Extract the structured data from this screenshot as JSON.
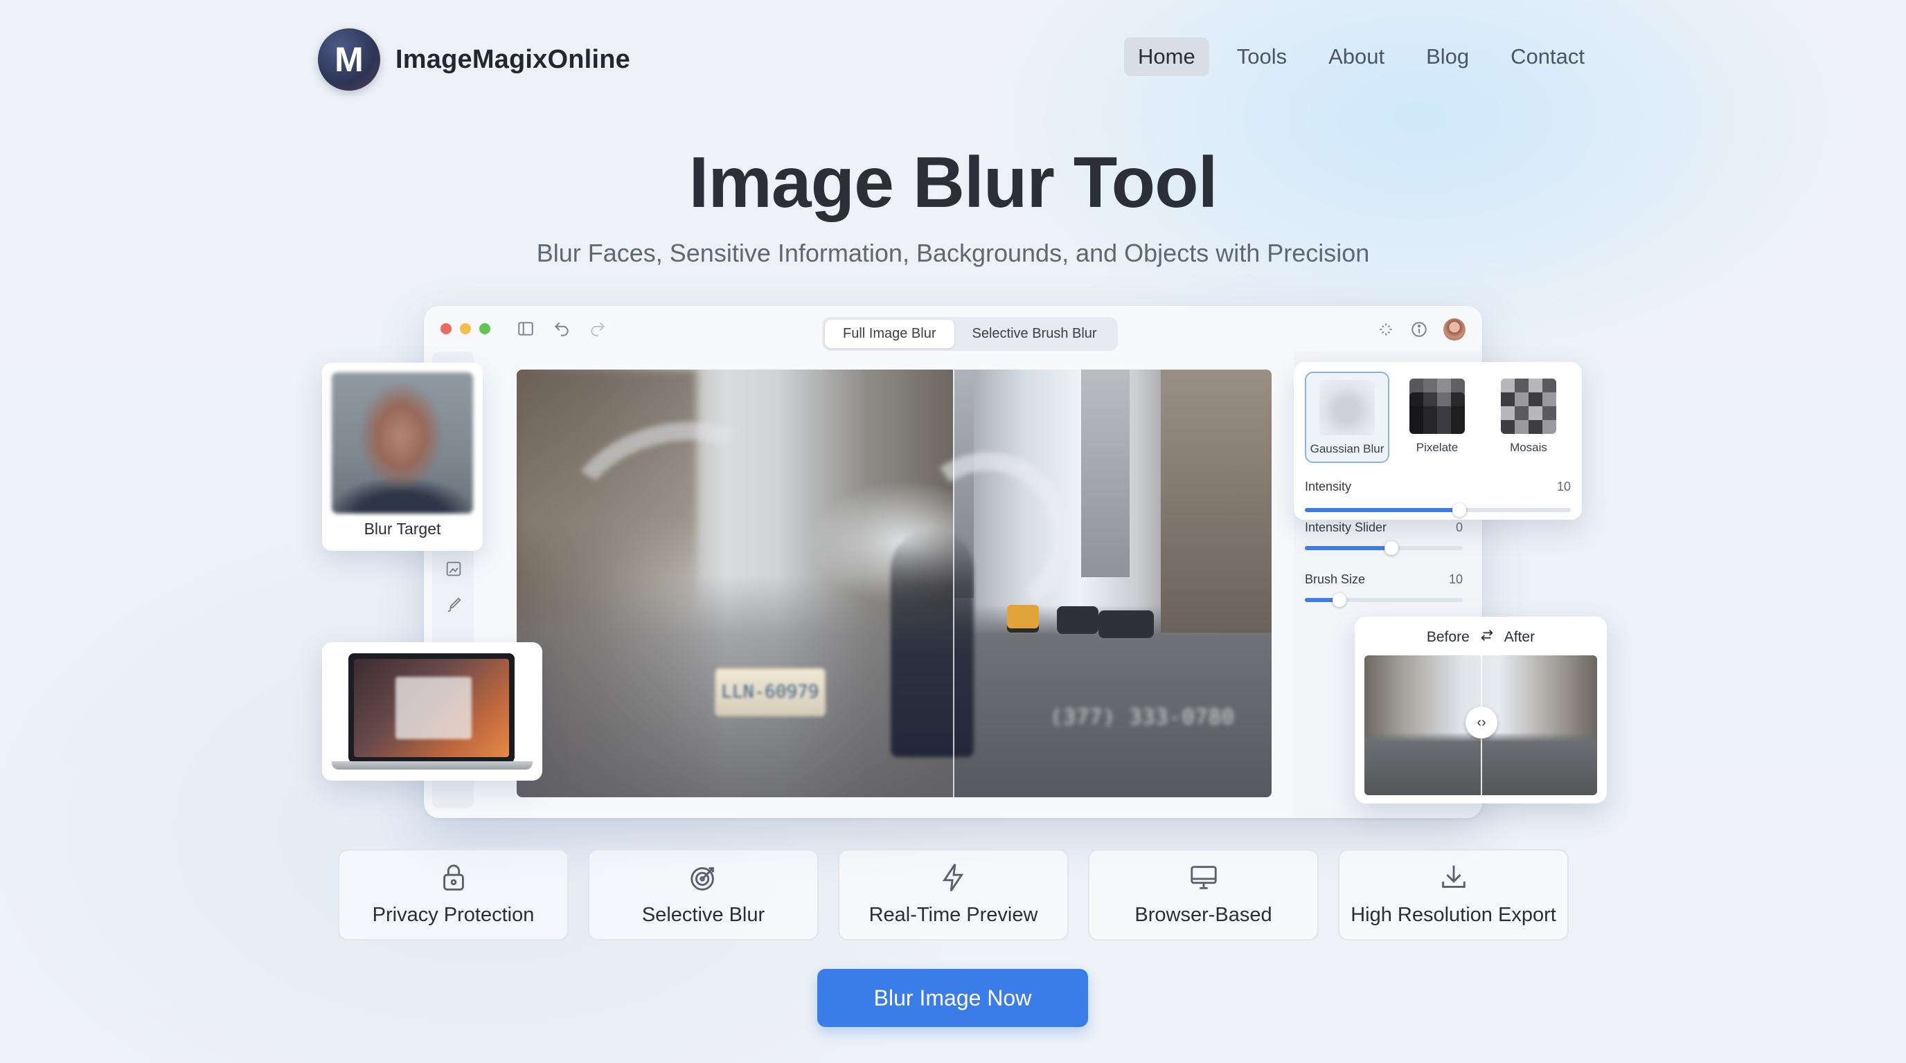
{
  "brand": {
    "logo_letter": "M",
    "name": "ImageMagixOnline"
  },
  "nav": {
    "items": [
      "Home",
      "Tools",
      "About",
      "Blog",
      "Contact"
    ],
    "active": "Home"
  },
  "hero": {
    "title": "Image Blur Tool",
    "subtitle": "Blur Faces, Sensitive Information, Backgrounds, and Objects with Precision"
  },
  "editor": {
    "modes": [
      "Full Image Blur",
      "Selective Brush Blur"
    ],
    "active_mode": "Full Image Blur",
    "plate_text": "LLN-60979",
    "phone_text": "(377) 333-0780"
  },
  "effects": {
    "options": [
      "Gaussian Blur",
      "Pixelate",
      "Mosais"
    ],
    "selected": "Gaussian Blur"
  },
  "sliders": [
    {
      "label": "Intensity",
      "value": "10",
      "level": 0.58
    },
    {
      "label": "Intensity Slider",
      "value": "0",
      "level": 0.55
    },
    {
      "label": "Brush Size",
      "value": "10",
      "level": 0.22
    }
  ],
  "compare": {
    "before": "Before",
    "after": "After",
    "position": 0.5
  },
  "blur_target": {
    "label": "Blur Target"
  },
  "features": [
    {
      "label": "Privacy Protection",
      "icon": "lock-icon"
    },
    {
      "label": "Selective Blur",
      "icon": "target-icon"
    },
    {
      "label": "Real-Time Preview",
      "icon": "lightning-icon"
    },
    {
      "label": "Browser-Based",
      "icon": "monitor-icon"
    },
    {
      "label": "High Resolution Export",
      "icon": "download-icon"
    }
  ],
  "cta": {
    "label": "Blur Image Now"
  },
  "colors": {
    "accent": "#3a7de8",
    "slider_fill": "#3f7ee0"
  }
}
